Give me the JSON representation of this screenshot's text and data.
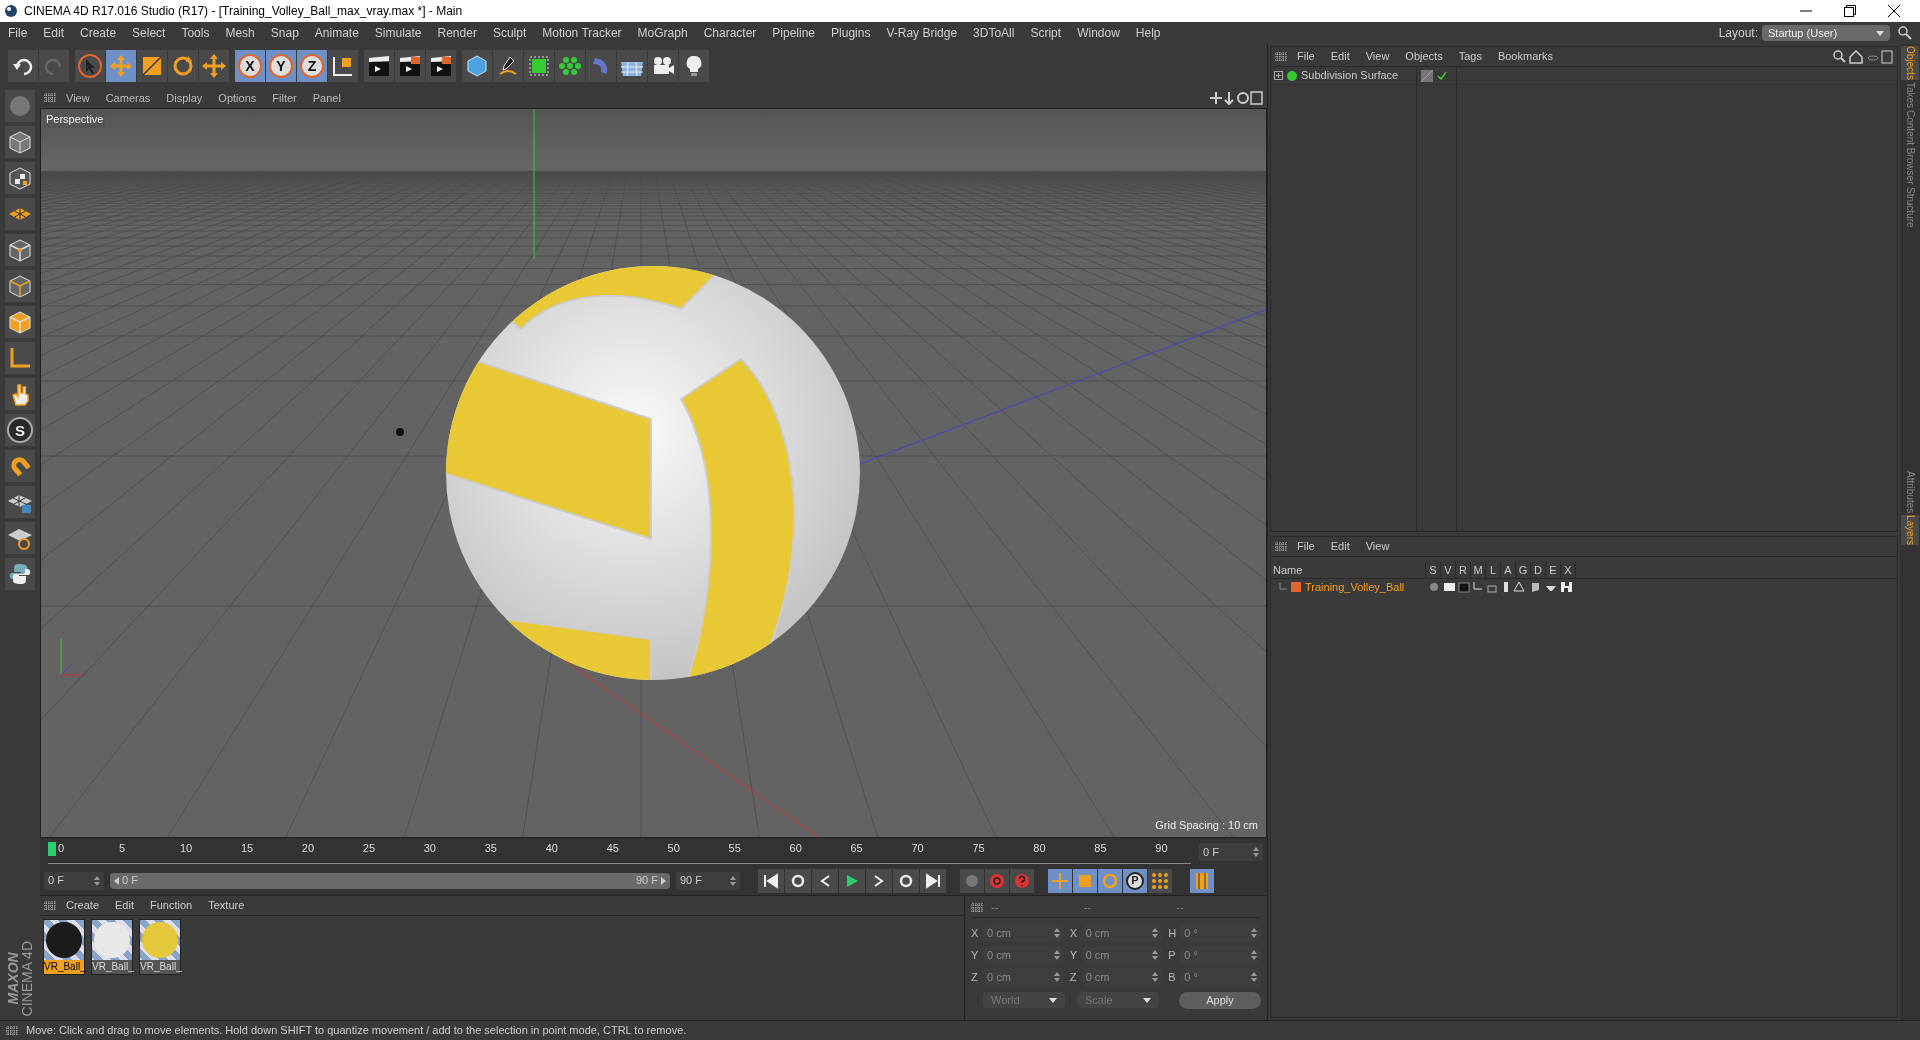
{
  "window": {
    "title": "CINEMA 4D R17.016 Studio (R17) - [Training_Volley_Ball_max_vray.max *] - Main"
  },
  "menu_bar": [
    "File",
    "Edit",
    "Create",
    "Select",
    "Tools",
    "Mesh",
    "Snap",
    "Animate",
    "Simulate",
    "Render",
    "Sculpt",
    "Motion Tracker",
    "MoGraph",
    "Character",
    "Pipeline",
    "Plugins",
    "V-Ray Bridge",
    "3DToAll",
    "Script",
    "Window",
    "Help"
  ],
  "layout": {
    "label": "Layout:",
    "value": "Startup (User)"
  },
  "toolbar": {
    "tools": [
      {
        "kind": "select",
        "selected": false
      },
      {
        "kind": "move",
        "selected": true
      },
      {
        "kind": "scale",
        "selected": false
      },
      {
        "kind": "rotate",
        "selected": false
      },
      {
        "kind": "recent",
        "selected": false
      }
    ],
    "axes": [
      {
        "label": "X",
        "selected": true
      },
      {
        "label": "Y",
        "selected": true
      },
      {
        "label": "Z",
        "selected": true
      }
    ]
  },
  "left_toolbar": [
    {
      "kind": "model"
    },
    {
      "kind": "texture"
    },
    {
      "kind": "workplane"
    },
    {
      "kind": "points"
    },
    {
      "kind": "edges"
    },
    {
      "kind": "polygons"
    },
    {
      "kind": "axis"
    },
    {
      "kind": "tweak"
    },
    {
      "kind": "snap",
      "label": "S"
    },
    {
      "kind": "magnet"
    },
    {
      "kind": "lock"
    },
    {
      "kind": "guide"
    },
    {
      "kind": "python"
    }
  ],
  "branding": {
    "company": "MAXON",
    "product": "CINEMA 4D"
  },
  "viewport": {
    "menu": [
      "View",
      "Cameras",
      "Display",
      "Options",
      "Filter",
      "Panel"
    ],
    "camera": "Perspective",
    "grid_spacing": "Grid Spacing : 10 cm"
  },
  "timeline": {
    "ticks": [
      "0",
      "5",
      "10",
      "15",
      "20",
      "25",
      "30",
      "35",
      "40",
      "45",
      "50",
      "55",
      "60",
      "65",
      "70",
      "75",
      "80",
      "85",
      "90"
    ],
    "current_frame": "0 F",
    "start": "0 F",
    "range_start": "0 F",
    "range_end": "90 F",
    "range_slider": {
      "level": 1
    },
    "end": "90 F",
    "key_tools": [
      {
        "kind": "position",
        "selected": true
      },
      {
        "kind": "scale",
        "selected": true
      },
      {
        "kind": "rotation",
        "selected": true
      },
      {
        "kind": "parameter",
        "selected": true,
        "label": "P"
      },
      {
        "kind": "points",
        "selected": false
      }
    ]
  },
  "materials": {
    "menu": [
      "Create",
      "Edit",
      "Function",
      "Texture"
    ],
    "items": [
      {
        "name": "VR_Ball_",
        "selected": true,
        "color": "#1c1c1c"
      },
      {
        "name": "VR_Ball_",
        "selected": false,
        "color": "#e8e8e8"
      },
      {
        "name": "VR_Ball_",
        "selected": false,
        "color": "#e2c83a"
      }
    ]
  },
  "coordinates": {
    "headers": [
      "--",
      "--",
      "--"
    ],
    "position": [
      {
        "axis": "X",
        "value": "0 cm"
      },
      {
        "axis": "Y",
        "value": "0 cm"
      },
      {
        "axis": "Z",
        "value": "0 cm"
      }
    ],
    "size": [
      {
        "axis": "X",
        "value": "0 cm"
      },
      {
        "axis": "Y",
        "value": "0 cm"
      },
      {
        "axis": "Z",
        "value": "0 cm"
      }
    ],
    "rotation": [
      {
        "axis": "H",
        "value": "0 °"
      },
      {
        "axis": "P",
        "value": "0 °"
      },
      {
        "axis": "B",
        "value": "0 °"
      }
    ],
    "space": "World",
    "mode": "Scale",
    "apply": "Apply"
  },
  "status_bar": "Move: Click and drag to move elements. Hold down SHIFT to quantize movement / add to the selection in point mode, CTRL to remove.",
  "objects_panel": {
    "menu": [
      "File",
      "Edit",
      "View",
      "Objects",
      "Tags",
      "Bookmarks"
    ],
    "objects": [
      {
        "name": "Subdivision Surface"
      }
    ]
  },
  "layers_panel": {
    "menu": [
      "File",
      "Edit",
      "View"
    ],
    "columns": [
      "Name",
      "S",
      "V",
      "R",
      "M",
      "L",
      "A",
      "G",
      "D",
      "E",
      "X"
    ],
    "layers": [
      {
        "name": "Training_Volley_Ball",
        "color": "#e0662a"
      }
    ]
  },
  "side_tabs": {
    "upper": [
      {
        "label": "Objects",
        "selected": true
      },
      {
        "label": "Takes",
        "selected": false
      },
      {
        "label": "Content Browser",
        "selected": false
      },
      {
        "label": "Structure",
        "selected": false
      }
    ],
    "lower": [
      {
        "label": "Attributes",
        "selected": false
      },
      {
        "label": "Layers",
        "selected": true
      }
    ]
  }
}
